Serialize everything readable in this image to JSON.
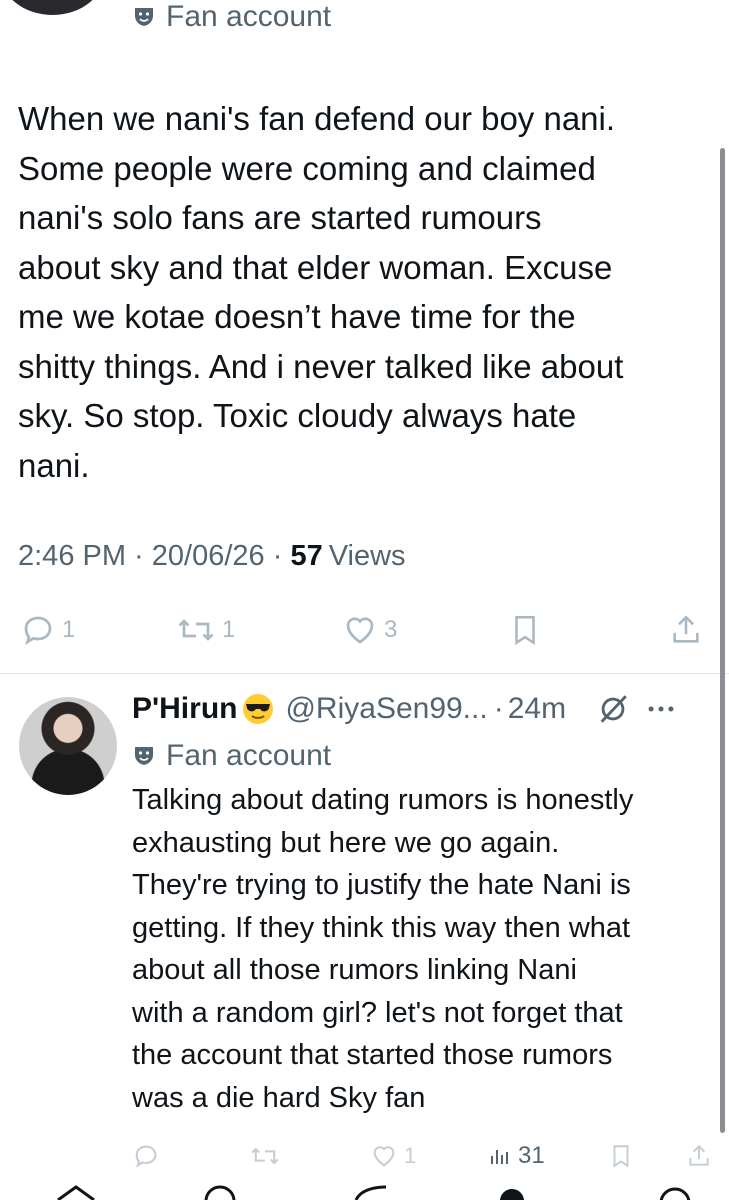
{
  "top_tweet": {
    "fan_label": "Fan account",
    "text": "When we nani's fan defend our boy nani.\nSome people were coming and claimed\nnani's solo fans are started rumours\nabout sky and that elder woman. Excuse\nme we kotae doesn’t have time for the\nshitty things. And i never talked like about\nsky. So stop. Toxic cloudy always hate\nnani.",
    "time": "2:46 PM",
    "sep1": " · ",
    "date": "20/06/26",
    "sep2": " · ",
    "views_count": "57",
    "views_label": "Views",
    "actions": {
      "reply_count": "1",
      "retweet_count": "1",
      "like_count": "3"
    }
  },
  "reply_tweet": {
    "name": "P'Hirun",
    "emoji": "sunglasses-emoji",
    "handle": "@RiyaSen99...",
    "dot": "·",
    "time_ago": "24m",
    "fan_label": "Fan account",
    "text": "Talking about dating rumors is honestly\nexhausting but here we go again.\nThey're trying to justify the hate Nani is\ngetting. If they think this way then what\nabout all those rumors linking Nani\nwith a random girl? let's not forget that\nthe account that started those rumors\nwas a die hard Sky fan",
    "actions": {
      "like_count": "1",
      "views_count": "31"
    }
  },
  "colors": {
    "text_primary": "#0f1419",
    "text_secondary": "#536471",
    "action_icon": "#aab8c2",
    "divider": "#e1e6ea"
  }
}
